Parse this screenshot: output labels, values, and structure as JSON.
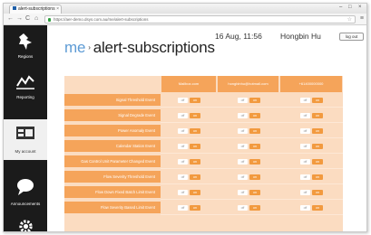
{
  "browser": {
    "tab_title": "alert-subscriptions",
    "url": "https://aer-demo.dsys.com.au/me/alert-subscriptions",
    "back_glyph": "←",
    "forward_glyph": "→",
    "reload_glyph": "C",
    "home_glyph": "⌂",
    "star_glyph": "☆",
    "menu_glyph": "≡",
    "tab_close": "×",
    "minimize": "–",
    "maximize": "□",
    "close": "×"
  },
  "sidebar": {
    "items": [
      {
        "label": "Regions",
        "icon": "map-pin-icon"
      },
      {
        "label": "Reporting",
        "icon": "line-chart-icon"
      },
      {
        "label": "My account",
        "icon": "id-card-icon",
        "active": true
      },
      {
        "label": "Announcements",
        "icon": "speech-bubble-icon"
      },
      {
        "label": "",
        "icon": "gear-icon"
      }
    ]
  },
  "header": {
    "crumb": "me",
    "separator": "›",
    "title": "alert-subscriptions",
    "timestamp": "16 Aug, 11:56",
    "user": "Hongbin Hu",
    "logout_label": "log out"
  },
  "table": {
    "columns": [
      "Mailbox.com",
      "hongbinhu@hotmail.com",
      "+61400000000"
    ],
    "rows": [
      "Signal Threshold Event",
      "Signal Degrade Event",
      "Power Anomaly Event",
      "Calendar Station Event",
      "Gas Control Unit Parameter Changed Event",
      "Flow Severity Threshold Event",
      "Flow Down Fixed Batch Limit Event",
      "Flow Severity Based Limit Event"
    ],
    "off_label": "off",
    "on_label": "on"
  },
  "colors": {
    "accent": "#f5a45a",
    "row_fill": "#fbdcc1",
    "toggle_on": "#f29a3f",
    "sidebar": "#1b1b1b",
    "link": "#5d9bd5"
  }
}
